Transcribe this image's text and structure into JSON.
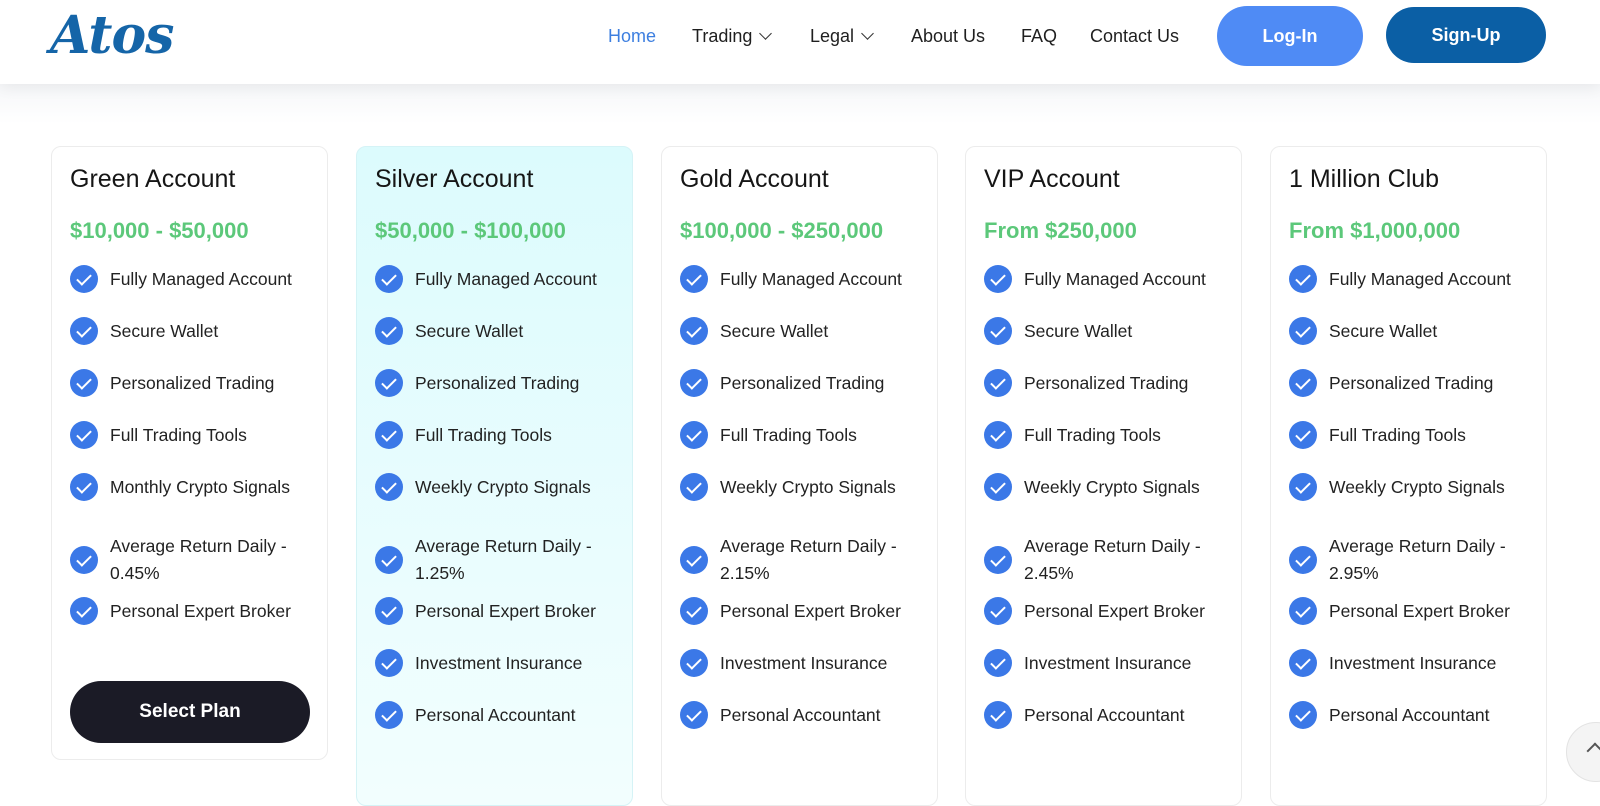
{
  "brand": {
    "logo_text": "Atos",
    "logo_color": "#1565a8"
  },
  "nav": {
    "items": [
      {
        "label": "Home",
        "active": true,
        "dropdown": false
      },
      {
        "label": "Trading",
        "active": false,
        "dropdown": true
      },
      {
        "label": "Legal",
        "active": false,
        "dropdown": true
      },
      {
        "label": "About Us",
        "active": false,
        "dropdown": false
      },
      {
        "label": "FAQ",
        "active": false,
        "dropdown": false
      },
      {
        "label": "Contact Us",
        "active": false,
        "dropdown": false
      }
    ],
    "login_label": "Log-In",
    "signup_label": "Sign-Up"
  },
  "colors": {
    "accent": "#3d7fe0",
    "login_button": "#4f8bf5",
    "signup_button": "#0b5fa5",
    "price_green": "#5cc87a",
    "check_blue": "#3b78e7",
    "select_button": "#1b1b26"
  },
  "plans": [
    {
      "title": "Green Account",
      "price": "$10,000 - $50,000",
      "features": [
        "Fully Managed Account",
        "Secure Wallet",
        "Personalized Trading",
        "Full Trading Tools",
        "Monthly Crypto Signals",
        "Average Return Daily - 0.45%",
        "Personal Expert Broker"
      ],
      "button_label": "Select Plan"
    },
    {
      "title": "Silver Account",
      "price": "$50,000 - $100,000",
      "features": [
        "Fully Managed Account",
        "Secure Wallet",
        "Personalized Trading",
        "Full Trading Tools",
        "Weekly Crypto Signals",
        "Average Return Daily - 1.25%",
        "Personal Expert Broker",
        "Investment Insurance",
        "Personal Accountant"
      ]
    },
    {
      "title": "Gold Account",
      "price": "$100,000 - $250,000",
      "features": [
        "Fully Managed Account",
        "Secure Wallet",
        "Personalized Trading",
        "Full Trading Tools",
        "Weekly Crypto Signals",
        "Average Return Daily - 2.15%",
        "Personal Expert Broker",
        "Investment Insurance",
        "Personal Accountant"
      ]
    },
    {
      "title": "VIP Account",
      "price": "From $250,000",
      "features": [
        "Fully Managed Account",
        "Secure Wallet",
        "Personalized Trading",
        "Full Trading Tools",
        "Weekly Crypto Signals",
        "Average Return Daily - 2.45%",
        "Personal Expert Broker",
        "Investment Insurance",
        "Personal Accountant"
      ]
    },
    {
      "title": "1 Million Club",
      "price": "From $1,000,000",
      "features": [
        "Fully Managed Account",
        "Secure Wallet",
        "Personalized Trading",
        "Full Trading Tools",
        "Weekly Crypto Signals",
        "Average Return Daily - 2.95%",
        "Personal Expert Broker",
        "Investment Insurance",
        "Personal Accountant"
      ]
    }
  ],
  "icons": {
    "feature_check": "check-circle-icon",
    "dropdown": "chevron-down-icon",
    "scroll": "chevron-up-icon"
  }
}
